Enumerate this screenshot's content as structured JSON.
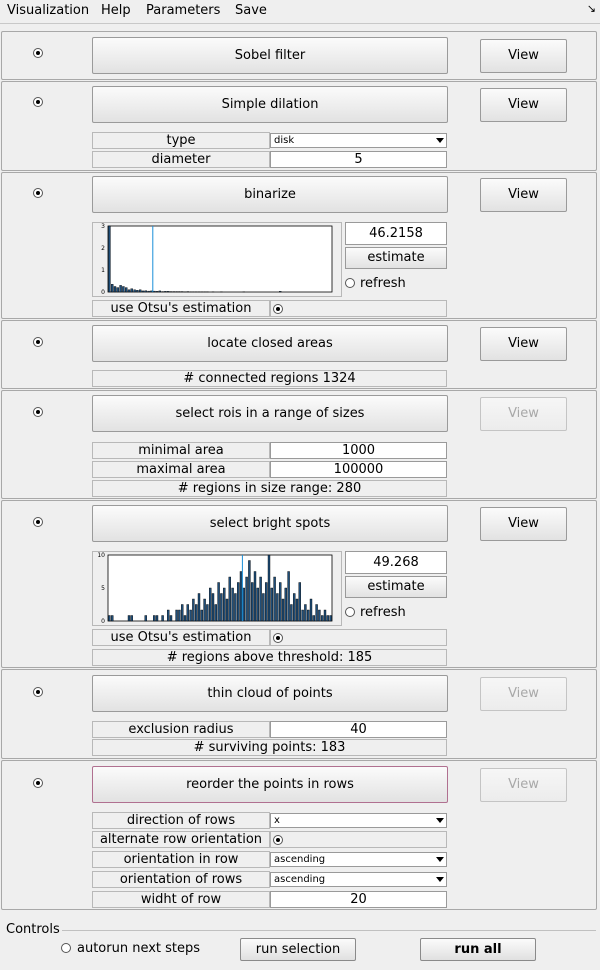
{
  "menu": [
    "Visualization",
    "Help",
    "Parameters",
    "Save"
  ],
  "steps": {
    "sobel": {
      "label": "Sobel filter",
      "view": "View"
    },
    "dilation": {
      "label": "Simple dilation",
      "view": "View",
      "type_label": "type",
      "type_value": "disk",
      "diameter_label": "diameter",
      "diameter_value": "5"
    },
    "binarize": {
      "label": "binarize",
      "view": "View",
      "estimate_value": "46.2158",
      "estimate_button": "estimate",
      "refresh": "refresh",
      "otsu_label": "use Otsu's estimation"
    },
    "closed": {
      "label": "locate closed areas",
      "view": "View",
      "summary": "# connected regions 1324"
    },
    "rois": {
      "label": "select rois in a range of sizes",
      "view": "View",
      "min_label": "minimal area",
      "min_value": "1000",
      "max_label": "maximal area",
      "max_value": "100000",
      "summary": "# regions in size range: 280"
    },
    "bright": {
      "label": "select bright spots",
      "view": "View",
      "estimate_value": "49.268",
      "estimate_button": "estimate",
      "refresh": "refresh",
      "otsu_label": "use Otsu's estimation",
      "summary": "# regions above threshold: 185"
    },
    "thin": {
      "label": "thin cloud of points",
      "view": "View",
      "radius_label": "exclusion radius",
      "radius_value": "40",
      "summary": "# surviving points: 183"
    },
    "reorder": {
      "label": "reorder the points in rows",
      "view": "View",
      "direction_label": "direction of rows",
      "direction_value": "x",
      "alternate_label": "alternate row orientation",
      "in_row_label": "orientation in row",
      "in_row_value": "ascending",
      "of_rows_label": "orientation of rows",
      "of_rows_value": "ascending",
      "width_label": "widht of row",
      "width_value": "20"
    }
  },
  "controls": {
    "title": "Controls",
    "autorun": "autorun next steps",
    "run_selection": "run selection",
    "run_all": "run all"
  },
  "histograms": {
    "binarize": {
      "ymax": 3,
      "yticks": [
        "3",
        "2",
        "1",
        "0"
      ],
      "bars": [
        3,
        0.35,
        0.25,
        0.2,
        0.3,
        0.25,
        0.2,
        0.1,
        0.15,
        0.1,
        0.08,
        0.1,
        0.05,
        0.06,
        0.04,
        0.05,
        0.04,
        0.03,
        0.05,
        0.02,
        0.03,
        0.03,
        0.02,
        0.02,
        0.02,
        0.02,
        0.02,
        0.01,
        0.02,
        0.01,
        0.01,
        0.01,
        0.01,
        0.01,
        0.01,
        0.01,
        0,
        0.01,
        0,
        0,
        0.01,
        0,
        0,
        0,
        0,
        0,
        0,
        0,
        0.01,
        0,
        0,
        0,
        0,
        0,
        0,
        0,
        0,
        0,
        0,
        0,
        0,
        0.03,
        0,
        0,
        0,
        0,
        0,
        0,
        0,
        0,
        0,
        0,
        0,
        0,
        0,
        0,
        0,
        0,
        0,
        0
      ],
      "threshold_fraction": 0.2
    },
    "bright": {
      "ymax": 12,
      "yticks": [
        "10",
        "5",
        "0"
      ],
      "bars": [
        1,
        1,
        0,
        0,
        0,
        0,
        0,
        1,
        1,
        0,
        0,
        0,
        0,
        1,
        0,
        0,
        1,
        1,
        0,
        1,
        0,
        2,
        1,
        0,
        2,
        2,
        3,
        1,
        3,
        2,
        4,
        3,
        5,
        2,
        4,
        3,
        6,
        5,
        3,
        7,
        5,
        6,
        4,
        8,
        6,
        5,
        7,
        9,
        6,
        8,
        11,
        7,
        9,
        6,
        8,
        5,
        7,
        12,
        6,
        8,
        5,
        7,
        4,
        6,
        9,
        3,
        5,
        4,
        7,
        2,
        3,
        2,
        4,
        1,
        3,
        2,
        1,
        2,
        1,
        1
      ],
      "threshold_fraction": 0.6
    }
  }
}
